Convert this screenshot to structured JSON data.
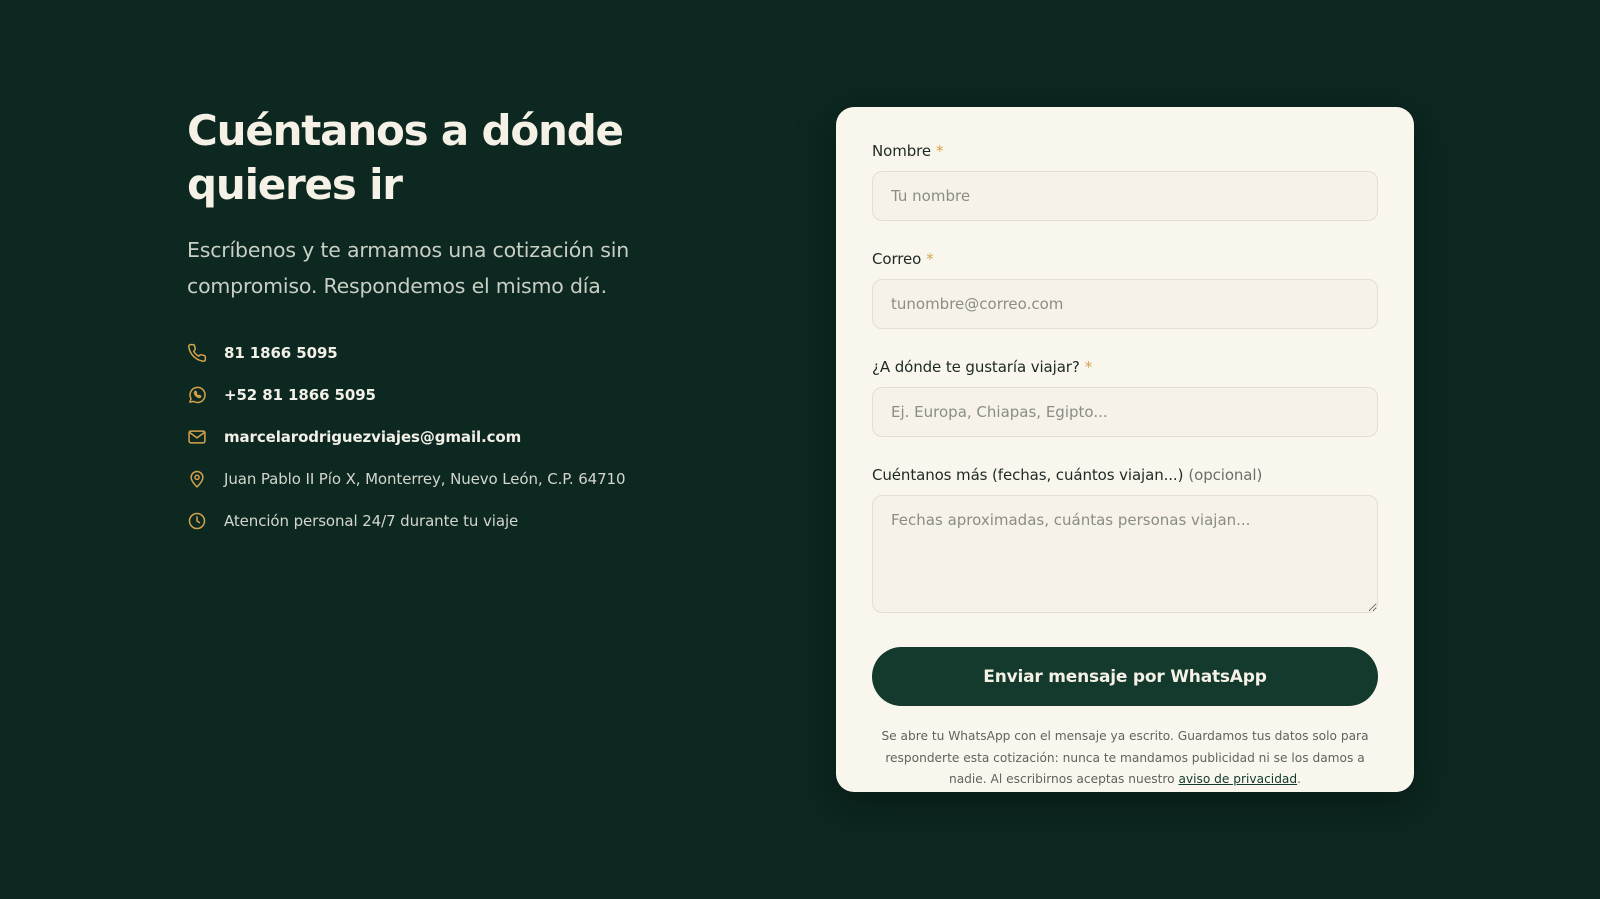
{
  "left": {
    "headline_line1": "Cuéntanos a dónde",
    "headline_line2": "quieres ir",
    "subtitle_line1": "Escríbenos y te armamos una cotización sin",
    "subtitle_line2": "compromiso. Respondemos el mismo día.",
    "contacts": [
      {
        "icon": "phone-icon",
        "text": "81 1866 5095"
      },
      {
        "icon": "whatsapp-icon",
        "text": "+52 81 1866 5095"
      },
      {
        "icon": "mail-icon",
        "text": "marcelarodriguezviajes@gmail.com"
      },
      {
        "icon": "location-pin-icon",
        "text": "Juan Pablo II Pío X, Monterrey, Nuevo León, C.P. 64710"
      },
      {
        "icon": "clock-icon",
        "text": "Atención personal 24/7 durante tu viaje"
      }
    ]
  },
  "form": {
    "name_label": "Nombre",
    "name_placeholder": "Tu nombre",
    "name_value": "",
    "email_label": "Correo",
    "email_placeholder": "tunombre@correo.com",
    "email_value": "",
    "destination_label": "¿A dónde te gustaría viajar?",
    "destination_placeholder": "Ej. Europa, Chiapas, Egipto...",
    "destination_value": "",
    "details_label": "Cuéntanos más (fechas, cuántos viajan...)",
    "details_optional": "(opcional)",
    "details_placeholder": "Fechas aproximadas, cuántas personas viajan...",
    "details_value": "",
    "required_mark": "*",
    "submit_label": "Enviar mensaje por WhatsApp",
    "disclaimer_text": "Se abre tu WhatsApp con el mensaje ya escrito. Guardamos tus datos solo para responderte esta cotización: nunca te mandamos publicidad ni se los damos a nadie. Al escribirnos aceptas nuestro ",
    "privacy_link": "aviso de privacidad",
    "disclaimer_end": "."
  },
  "colors": {
    "background": "#0c2820",
    "card": "#f9f6ee",
    "accent_gold": "#d4a24c",
    "button": "#133a2d"
  }
}
